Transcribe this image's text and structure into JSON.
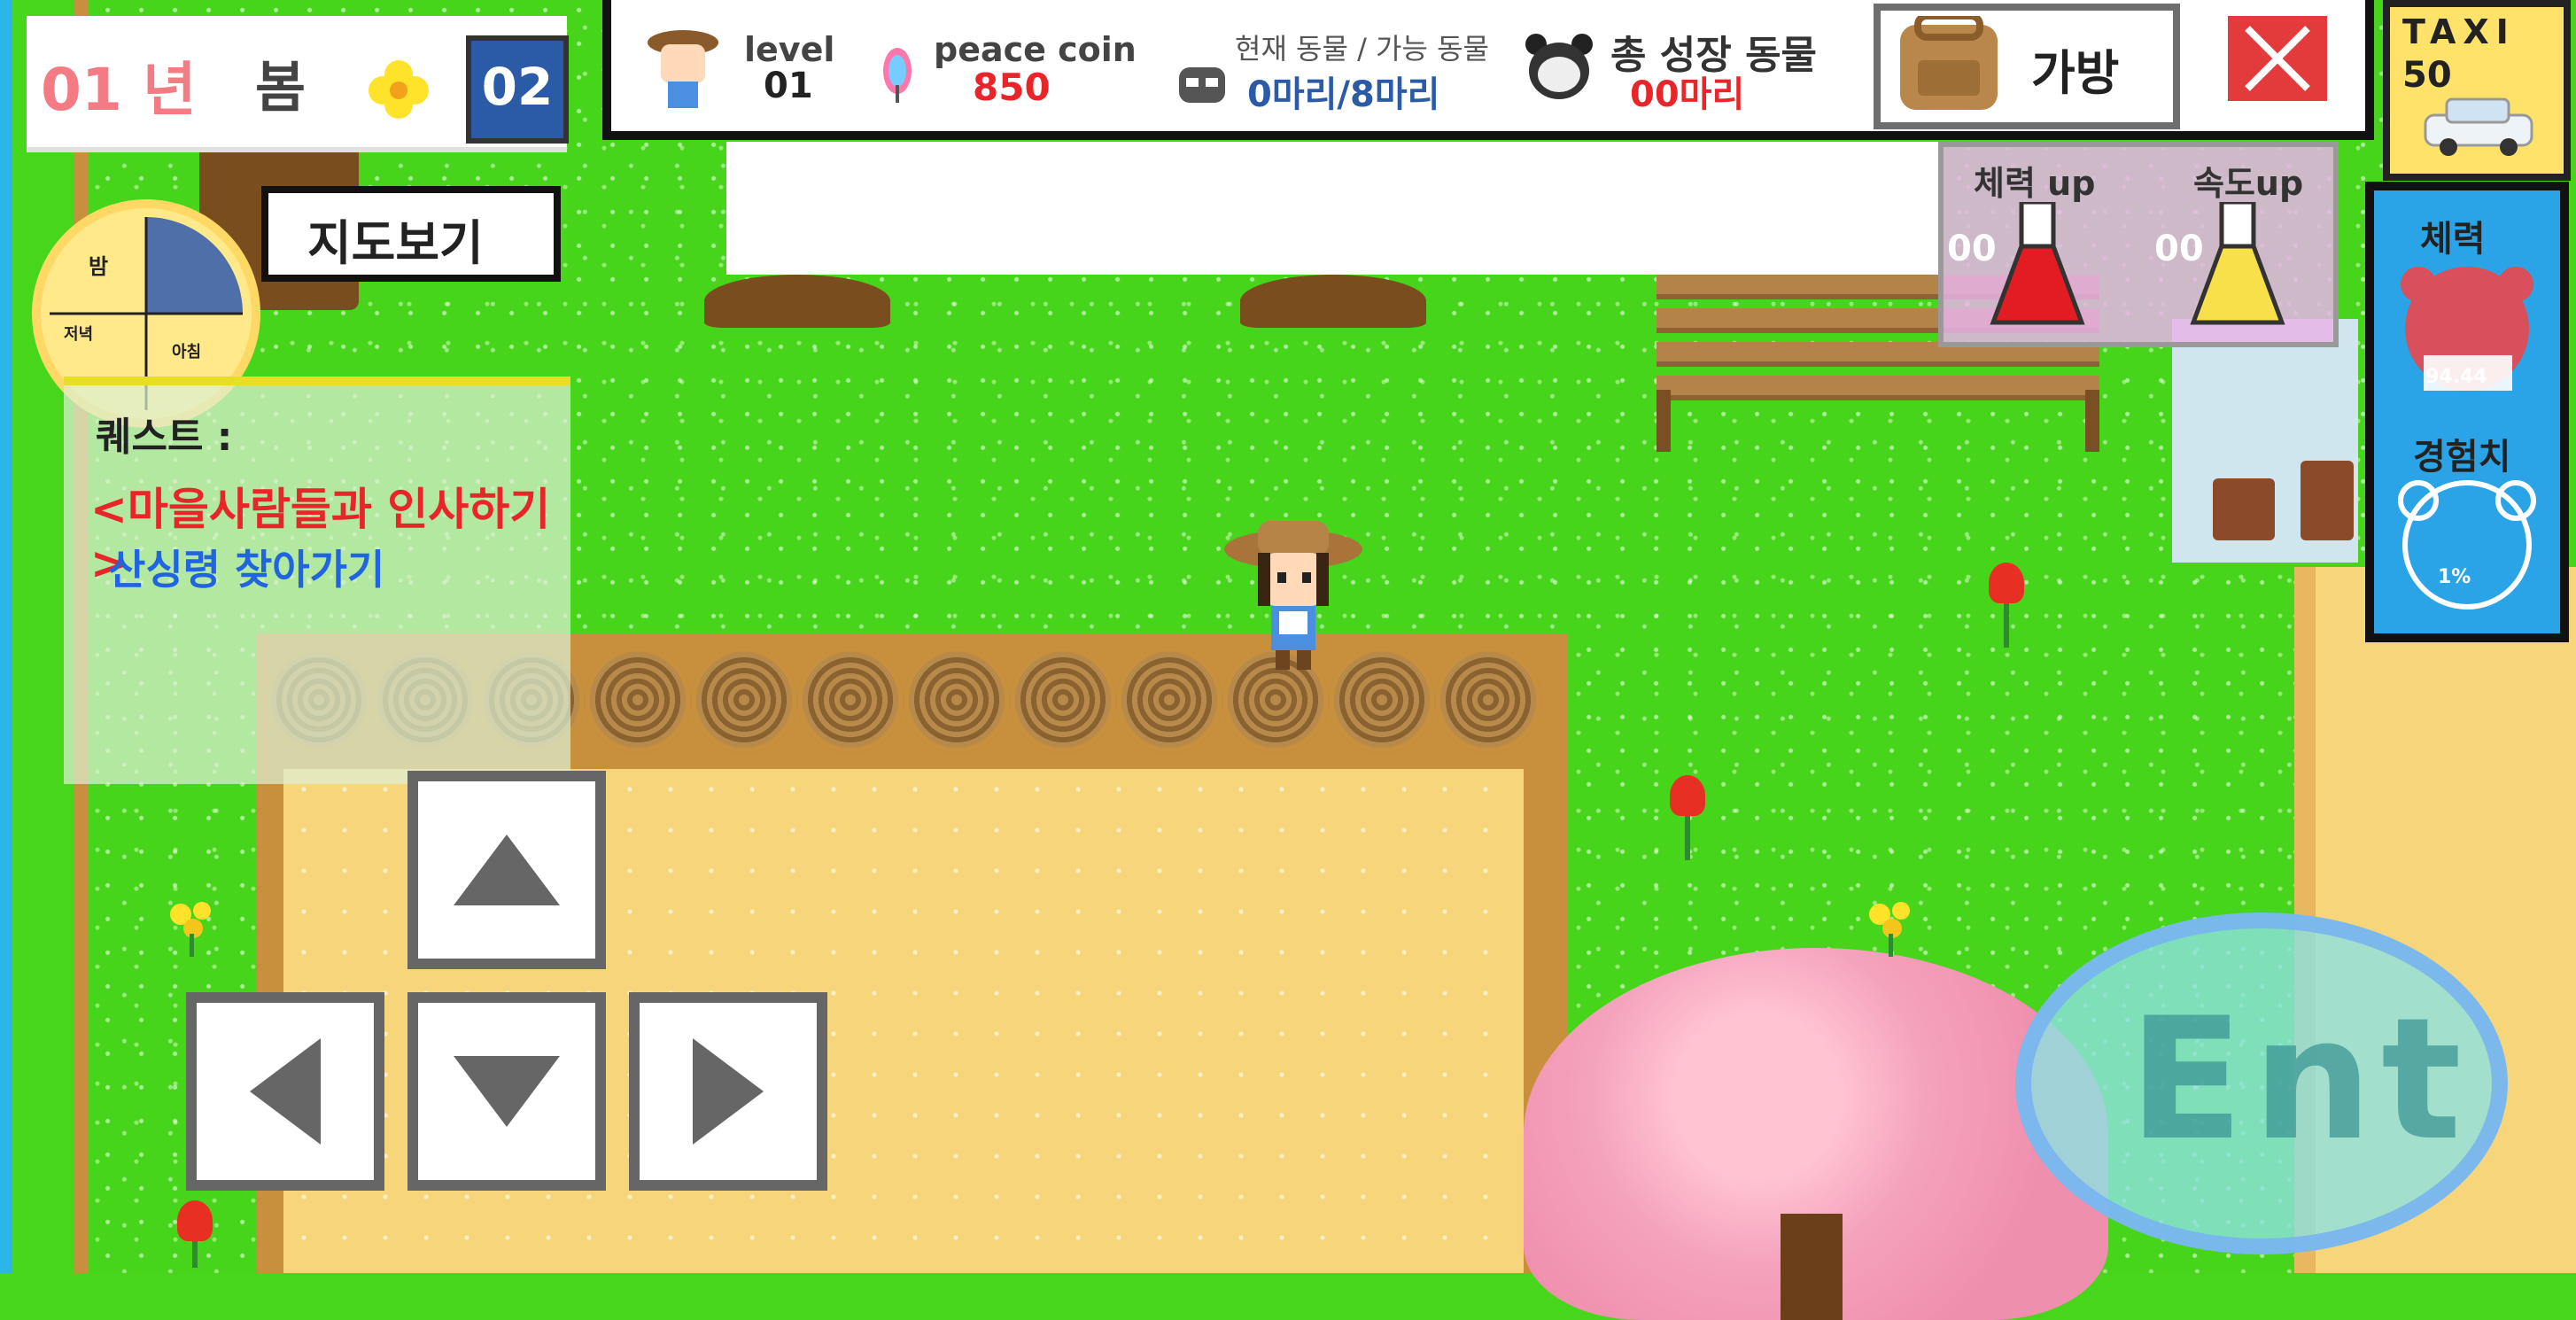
{
  "hud": {
    "year": "01 년",
    "season": "봄",
    "day": "02",
    "level_label": "level",
    "level_value": "01",
    "coin_label": "peace coin",
    "coin_value": "850",
    "animals_label": "현재 동물 / 가능 동물",
    "animals_value": "0마리/8마리",
    "grown_label": "총 성장 동물",
    "grown_value": "00마리",
    "bag_label": "가방"
  },
  "taxi": {
    "label": "TAXI",
    "value": "50"
  },
  "potions": {
    "hp_label": "체력 up",
    "hp_count": "00",
    "speed_label": "속도up",
    "speed_count": "00"
  },
  "stats": {
    "hp_label": "체력",
    "hp_value": "94.44",
    "exp_label": "경험치",
    "exp_value": "1%"
  },
  "map_button": "지도보기",
  "clock": {
    "night": "밤",
    "label_a": "저녁",
    "label_b": "아침"
  },
  "quest": {
    "title": "퀘스트 :",
    "main": "<마을사람들과 인사하기>",
    "sub": "산싱령 찾아가기"
  },
  "enter_button": "Ent",
  "colors": {
    "grass": "#46d51b",
    "coin_red": "#e8262a",
    "animal_blue": "#2b5aa7",
    "stat_blue": "#2aa4e6",
    "close_red": "#e33b3b"
  },
  "icons": [
    "farmer-avatar-icon",
    "rainbow-feather-icon",
    "raccoon-icon",
    "panda-icon",
    "backpack-icon",
    "close-icon",
    "taxi-icon",
    "red-potion-icon",
    "yellow-potion-icon",
    "hp-bear-icon",
    "exp-bear-icon",
    "arrow-up-icon",
    "arrow-left-icon",
    "arrow-down-icon",
    "arrow-right-icon"
  ]
}
